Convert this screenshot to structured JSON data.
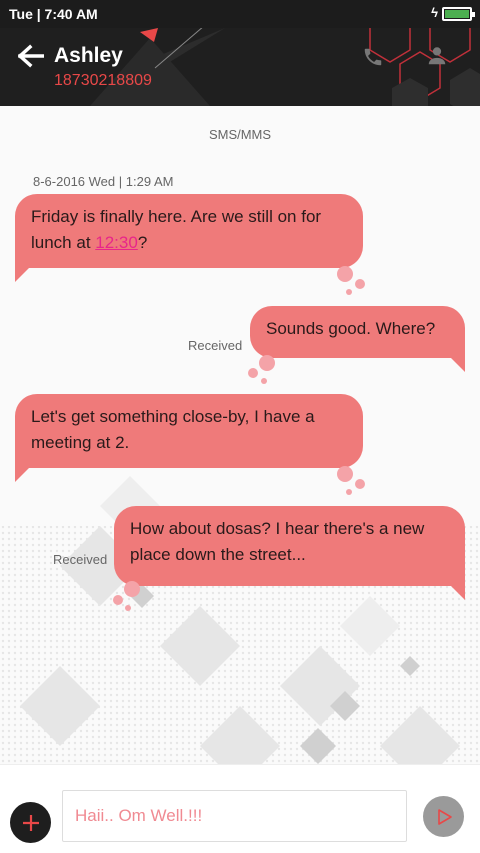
{
  "status_bar": {
    "day_time": "Tue | 7:40 AM"
  },
  "header": {
    "contact_name": "Ashley",
    "contact_number": "18730218809",
    "icons": [
      "back-arrow-icon",
      "phone-icon",
      "person-icon"
    ]
  },
  "conversation": {
    "channel_label": "SMS/MMS",
    "timestamp": "8-6-2016 Wed | 1:29 AM",
    "messages": [
      {
        "direction": "incoming",
        "text_before_link": "Friday is finally here. Are we still on for lunch at ",
        "link": "12:30",
        "text_after_link": "?"
      },
      {
        "direction": "outgoing",
        "text": "Sounds good. Where?",
        "status": "Received"
      },
      {
        "direction": "incoming",
        "text": "Let's get something close-by, I have a meeting at 2."
      },
      {
        "direction": "outgoing",
        "text": "How about dosas? I hear there's a new place down the street...",
        "status": "Received"
      }
    ]
  },
  "compose": {
    "input_value": "Haii.. Om Well.!!!",
    "icons": [
      "add-icon",
      "send-icon"
    ]
  },
  "colors": {
    "bubble": "#ef7a7a",
    "accent": "#e84848",
    "link": "#e8268a",
    "header_bg": "#1f1f1f"
  }
}
